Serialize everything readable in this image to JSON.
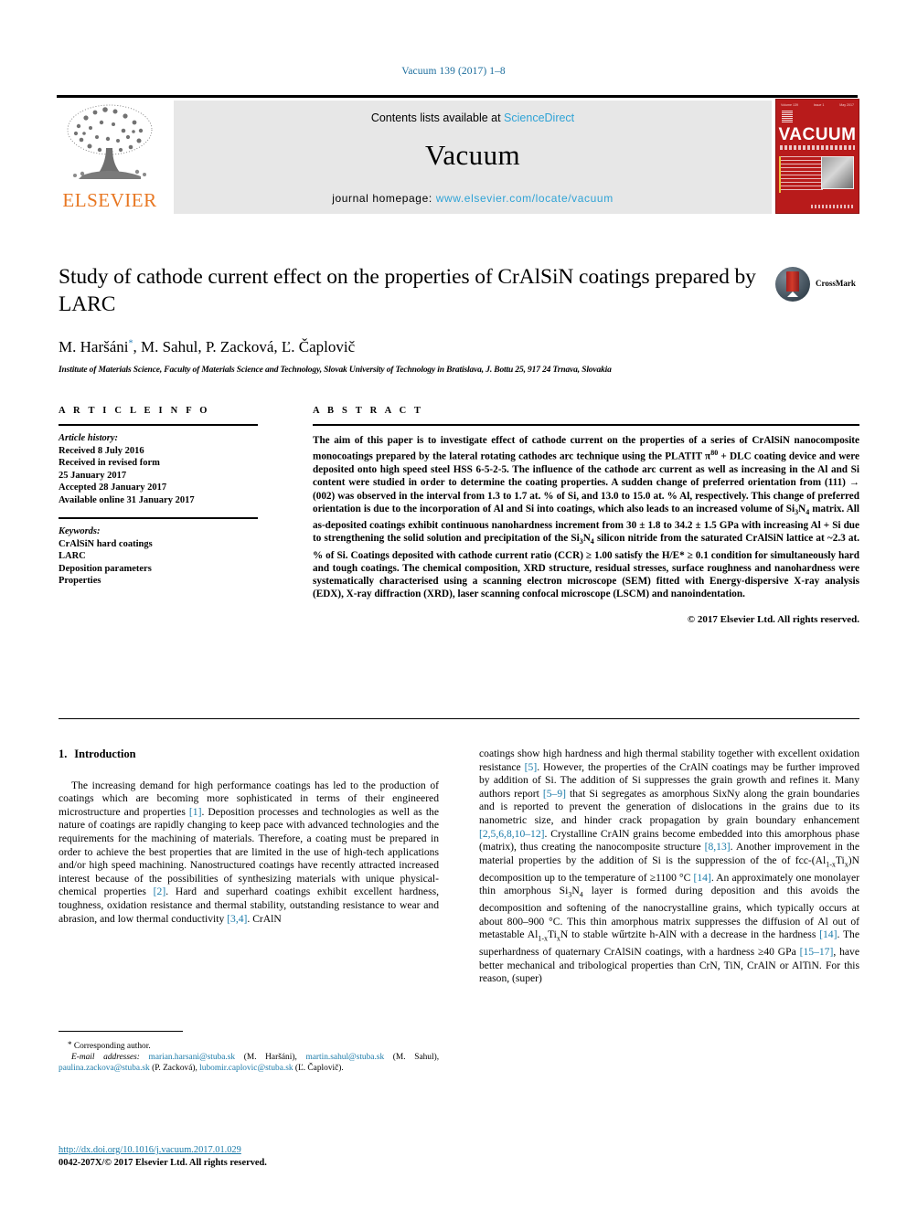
{
  "running_head": "Vacuum 139 (2017) 1–8",
  "masthead": {
    "publisher": "ELSEVIER",
    "contents_prefix": "Contents lists available at ",
    "contents_link": "ScienceDirect",
    "journal_name": "Vacuum",
    "homepage_label": "journal homepage: ",
    "homepage_url": "www.elsevier.com/locate/vacuum",
    "cover": {
      "title": "VACUUM",
      "top_left": "Volume 139",
      "top_mid": "Issue 1",
      "top_right": "May 2017",
      "accent_color": "#b81b1b"
    },
    "link_color": "#2fa3d6"
  },
  "article": {
    "title": "Study of cathode current effect on the properties of CrAlSiN coatings prepared by LARC",
    "authors": "M. Haršáni, M. Sahul, P. Zacková, Ľ. Čaplovič",
    "author_marker": "*",
    "affiliation": "Institute of Materials Science, Faculty of Materials Science and Technology, Slovak University of Technology in Bratislava, J. Bottu 25, 917 24 Trnava, Slovakia",
    "crossmark_label": "CrossMark"
  },
  "info": {
    "heading": "A R T I C L E   I N F O",
    "history_label": "Article history:",
    "history_lines": [
      "Received 8 July 2016",
      "Received in revised form",
      "25 January 2017",
      "Accepted 28 January 2017",
      "Available online 31 January 2017"
    ],
    "keywords_label": "Keywords:",
    "keywords": [
      "CrAlSiN hard coatings",
      "LARC",
      "Deposition parameters",
      "Properties"
    ]
  },
  "abstract": {
    "heading": "A B S T R A C T",
    "text_part1": "The aim of this paper is to investigate effect of cathode current on the properties of a series of CrAlSiN nanocomposite monocoatings prepared by the lateral rotating cathodes arc technique using the PLATIT π",
    "pi_sup": "80",
    "text_part2": " + DLC coating device and were deposited onto high speed steel HSS 6-5-2-5. The influence of the cathode arc current as well as increasing in the Al and Si content were studied in order to determine the coating properties. A sudden change of preferred orientation from (111) → (002) was observed in the interval from 1.3 to 1.7 at. % of Si, and 13.0 to 15.0 at. % Al, respectively. This change of preferred orientation is due to the incorporation of Al and Si into coatings, which also leads to an increased volume of Si",
    "si3n4_a_sub": "3",
    "text_part3": "N",
    "si3n4_a_sub2": "4",
    "text_part4": " matrix. All as-deposited coatings exhibit continuous nanohardness increment from 30 ± 1.8 to 34.2 ± 1.5 GPa with increasing Al + Si due to strengthening the solid solution and precipitation of the Si",
    "si3n4_b_sub": "3",
    "text_part5": "N",
    "si3n4_b_sub2": "4",
    "text_part6": " silicon nitride from the saturated CrAlSiN lattice at ~2.3 at. % of Si. Coatings deposited with cathode current ratio (CCR) ≥ 1.00 satisfy the H/E* ≥ 0.1 condition for simultaneously hard and tough coatings. The chemical composition, XRD structure, residual stresses, surface roughness and nanohardness were systematically characterised using a scanning electron microscope (SEM) fitted with Energy-dispersive X-ray analysis (EDX), X-ray diffraction (XRD), laser scanning confocal microscope (LSCM) and nanoindentation.",
    "copyright": "© 2017 Elsevier Ltd. All rights reserved."
  },
  "body": {
    "section_number": "1.",
    "section_title": "Introduction",
    "left_col": {
      "p1_a": "The increasing demand for high performance coatings has led to the production of coatings which are becoming more sophisticated in terms of their engineered microstructure and properties ",
      "ref1": "[1]",
      "p1_b": ". Deposition processes and technologies as well as the nature of coatings are rapidly changing to keep pace with advanced technologies and the requirements for the machining of materials. Therefore, a coating must be prepared in order to achieve the best properties that are limited in the use of high-tech applications and/or high speed machining. Nanostructured coatings have recently attracted increased interest because of the possibilities of synthesizing materials with unique physical-chemical properties ",
      "ref2": "[2]",
      "p1_c": ". Hard and superhard coatings exhibit excellent hardness, toughness, oxidation resistance and thermal stability, outstanding resistance to wear and abrasion, and low thermal conductivity ",
      "ref3": "[3,4]",
      "p1_d": ". CrAlN"
    },
    "right_col": {
      "a": "coatings show high hardness and high thermal stability together with excellent oxidation resistance ",
      "ref5": "[5]",
      "b": ". However, the properties of the CrAlN coatings may be further improved by addition of Si. The addition of Si suppresses the grain growth and refines it. Many authors report ",
      "ref59": "[5–9]",
      "c": " that Si segregates as amorphous SixNy along the grain boundaries and is reported to prevent the generation of dislocations in the grains due to its nanometric size, and hinder crack propagation by grain boundary enhancement ",
      "ref_multi": "[2,5,6,8,10–12]",
      "d": ". Crystalline CrAlN grains become embedded into this amorphous phase (matrix), thus creating the nanocomposite structure ",
      "ref813": "[8,13]",
      "e": ". Another improvement in the material properties by the addition of Si is the suppression of the of fcc-(Al",
      "sub1": "1-x",
      "e2": "Ti",
      "sub2": "x",
      "e3": ")N decomposition up to the temperature of ≥1100 °C ",
      "ref14": "[14]",
      "f": ". An approximately one monolayer thin amorphous Si",
      "sub3": "3",
      "f2": "N",
      "sub4": "4",
      "f3": " layer is formed during deposition and this avoids the decomposition and softening of the nanocrystalline grains, which typically occurs at about 800–900 °C. This thin amorphous matrix suppresses the diffusion of Al out of metastable Al",
      "sub5": "1-x",
      "f4": "Ti",
      "sub6": "x",
      "f5": "N to stable wűrtzite h-AlN with a decrease in the hardness ",
      "ref14b": "[14]",
      "g": ". The superhardness of quaternary CrAlSiN coatings, with a hardness ≥40 GPa ",
      "ref1517": "[15–17]",
      "h": ", have better mechanical and tribological properties than CrN, TiN, CrAlN or AlTiN. For this reason, (super)"
    }
  },
  "footnotes": {
    "corresponding": "Corresponding author.",
    "email_label": "E-mail addresses:",
    "emails": [
      {
        "address": "marian.harsani@stuba.sk",
        "name": "(M. Haršáni)"
      },
      {
        "address": "martin.sahul@stuba.sk",
        "name": "(M. Sahul)"
      },
      {
        "address": "paulina.zackova@stuba.sk",
        "name": "(P. Zacková)"
      },
      {
        "address": "lubomir.caplovic@stuba.sk",
        "name": "(Ľ. Čaplovič)"
      }
    ],
    "doi": "http://dx.doi.org/10.1016/j.vacuum.2017.01.029",
    "issn_line": "0042-207X/© 2017 Elsevier Ltd. All rights reserved."
  }
}
